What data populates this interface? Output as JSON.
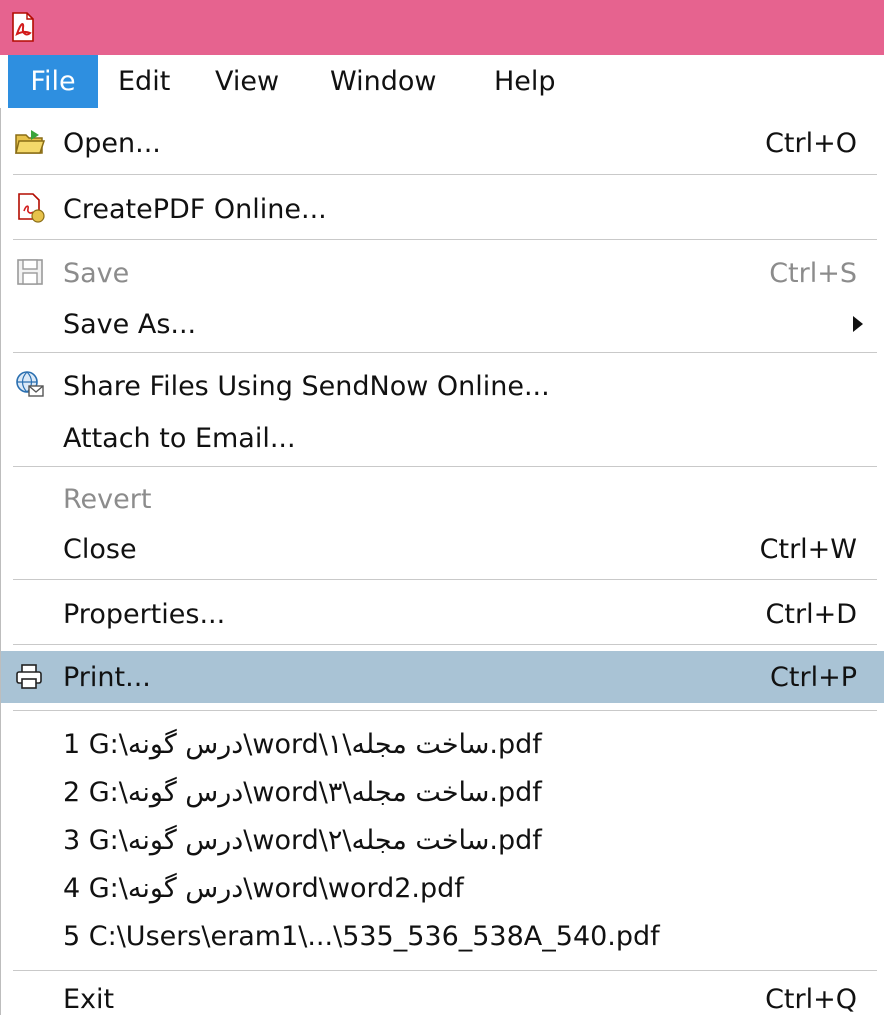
{
  "menubar": {
    "items": [
      "File",
      "Edit",
      "View",
      "Window",
      "Help"
    ],
    "active": "File"
  },
  "menu": {
    "open": {
      "label": "Open...",
      "shortcut": "Ctrl+O"
    },
    "createpdf": {
      "label": "CreatePDF Online..."
    },
    "save": {
      "label": "Save",
      "shortcut": "Ctrl+S"
    },
    "saveas": {
      "label": "Save As..."
    },
    "share": {
      "label": "Share Files Using SendNow Online..."
    },
    "attach": {
      "label": "Attach to Email..."
    },
    "revert": {
      "label": "Revert"
    },
    "close": {
      "label": "Close",
      "shortcut": "Ctrl+W"
    },
    "properties": {
      "label": "Properties...",
      "shortcut": "Ctrl+D"
    },
    "print": {
      "label": "Print...",
      "shortcut": "Ctrl+P"
    },
    "recent": [
      "1 G:\\درس گونه\\word\\ساخت مجله\\۱.pdf",
      "2 G:\\درس گونه\\word\\ساخت مجله\\۳.pdf",
      "3 G:\\درس گونه\\word\\ساخت مجله\\۲.pdf",
      "4 G:\\درس گونه\\word\\word2.pdf",
      "5 C:\\Users\\eram1\\...\\535_536_538A_540.pdf"
    ],
    "exit": {
      "label": "Exit",
      "shortcut": "Ctrl+Q"
    }
  },
  "icons": {
    "app": "acrobat-pdf-icon",
    "open": "open-folder-icon",
    "createpdf": "create-pdf-icon",
    "save": "save-disk-icon",
    "share": "share-globe-icon",
    "print": "printer-icon"
  },
  "colors": {
    "titlebar": "#e6638f",
    "active_menu": "#2e8fe0",
    "highlight": "#a9c3d5",
    "disabled_text": "#8c8c8c"
  }
}
